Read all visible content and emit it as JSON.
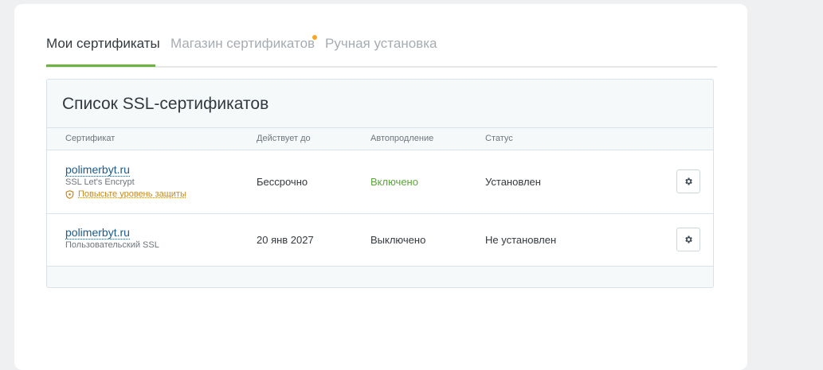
{
  "tabs": [
    {
      "label": "Мои сертификаты",
      "active": true
    },
    {
      "label": "Магазин сертификатов",
      "active": false,
      "has_notification_dot": true
    },
    {
      "label": "Ручная установка",
      "active": false
    }
  ],
  "card": {
    "title": "Список SSL-сертификатов"
  },
  "table": {
    "headers": [
      "Сертификат",
      "Действует до",
      "Автопродление",
      "Статус"
    ],
    "rows": [
      {
        "domain": "polimerbyt.ru",
        "type": "SSL Let's Encrypt",
        "upgrade_link": "Повысьте уровень защиты",
        "valid_until": "Бессрочно",
        "autorenew": "Включено",
        "status": "Установлен",
        "action_icon": "gear-icon"
      },
      {
        "domain": "polimerbyt.ru",
        "type": "Пользовательский SSL",
        "valid_until": "20 янв 2027",
        "autorenew": "Выключено",
        "status": "Не установлен",
        "action_icon": "gear-icon"
      }
    ]
  },
  "colors": {
    "active_tab_underline": "#6db33f",
    "notification_dot": "#f5a623",
    "link": "#1c5a8c",
    "autorenew_on": "#5aa637",
    "upgrade_link": "#c78a1e"
  }
}
